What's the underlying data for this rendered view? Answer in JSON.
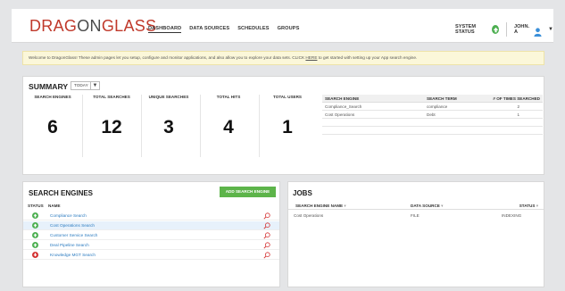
{
  "header": {
    "logo_part1": "DRAG",
    "logo_part2": "ON",
    "logo_part3": "GLASS",
    "nav": [
      "DASHBOARD",
      "DATA SOURCES",
      "SCHEDULES",
      "GROUPS"
    ],
    "active_nav": "DASHBOARD",
    "system_status_label": "SYSTEM STATUS",
    "system_status_color": "#4caf50",
    "user_label": "JOHN. A",
    "user_icon": "user-icon"
  },
  "welcome": {
    "text_before": "Welcome to DragonGlass!  These admin pages let you setup, configure and monitor applications, and also allow you to explore your data sets. CLICK ",
    "link": "HERE",
    "text_after": " to get started with setting up your App search engine."
  },
  "summary": {
    "title": "SUMMARY",
    "period": "TODAY",
    "stats": [
      {
        "label": "SEARCH ENGINES",
        "value": "6"
      },
      {
        "label": "TOTAL SEARCHES",
        "value": "12"
      },
      {
        "label": "UNIQUE SEARCHES",
        "value": "3"
      },
      {
        "label": "TOTAL HITS",
        "value": "4"
      },
      {
        "label": "TOTAL USERS",
        "value": "1"
      }
    ],
    "table": {
      "headers": [
        "SEARCH ENGINE",
        "SEARCH TERM",
        "# OF TIMES SEARCHED"
      ],
      "rows": [
        [
          "Compliance_Search",
          "compliance",
          "2"
        ],
        [
          "Cost Operations",
          "Debt",
          "1"
        ]
      ]
    }
  },
  "search_engines": {
    "title": "SEARCH ENGINES",
    "add_button": "ADD SEARCH ENGINE",
    "col_status": "STATUS",
    "col_name": "NAME",
    "rows": [
      {
        "name": "Compliance Search",
        "status": "up"
      },
      {
        "name": "Cost Operations Search",
        "status": "up"
      },
      {
        "name": "Customer Service Search",
        "status": "up"
      },
      {
        "name": "Deal Pipeline Search",
        "status": "up"
      },
      {
        "name": "Knowledge MGT Search",
        "status": "down"
      }
    ],
    "colors": {
      "up": "#4caf50",
      "down": "#d32f2f",
      "highlight": "#e7f1fb"
    }
  },
  "jobs": {
    "title": "JOBS",
    "headers": [
      "SEARCH ENGINE NAME",
      "DATA SOURCE",
      "STATUS"
    ],
    "rows": [
      [
        "Cost Operations",
        "FILE",
        "INDEXING"
      ]
    ]
  }
}
